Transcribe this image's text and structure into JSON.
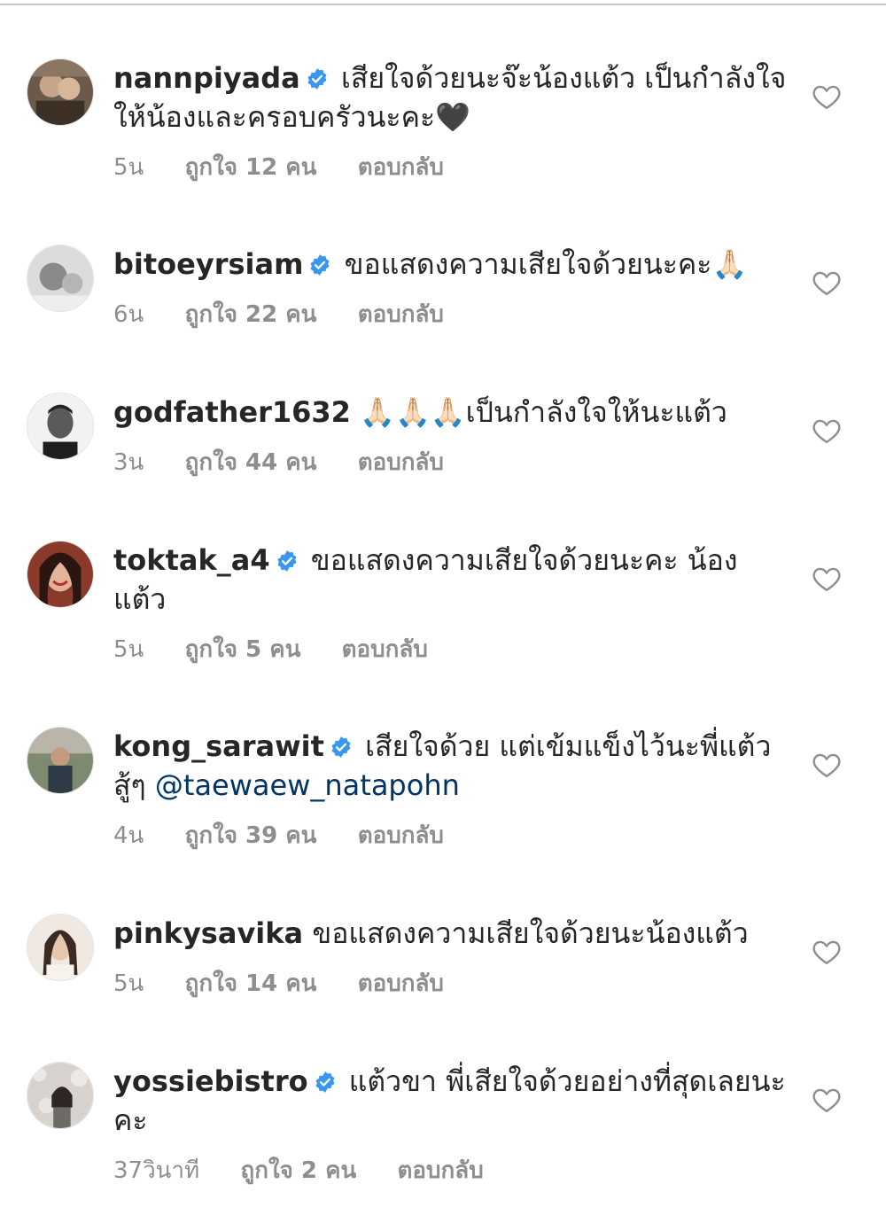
{
  "comments": [
    {
      "username": "nannpiyada",
      "verified": true,
      "text": "เสียใจด้วยนะจ๊ะน้องแต้ว เป็นกำลังใจให้น้องและครอบครัวนะคะ🖤",
      "time": "5น",
      "likes": "ถูกใจ 12 คน",
      "reply": "ตอบกลับ",
      "avatar_color": "#6b5a4a"
    },
    {
      "username": "bitoeyrsiam",
      "verified": true,
      "text": "ขอแสดงความเสียใจด้วยนะคะ🙏🏻",
      "time": "6น",
      "likes": "ถูกใจ 22 คน",
      "reply": "ตอบกลับ",
      "avatar_color": "#9a9a9a"
    },
    {
      "username": "godfather1632",
      "verified": false,
      "text": "🙏🏻🙏🏻🙏🏻เป็นกำลังใจให้นะแต้ว",
      "time": "3น",
      "likes": "ถูกใจ 44 คน",
      "reply": "ตอบกลับ",
      "avatar_color": "#3a3a3a"
    },
    {
      "username": "toktak_a4",
      "verified": true,
      "text": "ขอแสดงความเสียใจด้วยนะคะ น้องแต้ว",
      "time": "5น",
      "likes": "ถูกใจ 5 คน",
      "reply": "ตอบกลับ",
      "avatar_color": "#8a3a2a"
    },
    {
      "username": "kong_sarawit",
      "verified": true,
      "text": "เสียใจด้วย แต่เข้มแข็งไว้นะพี่แต้ว สู้ๆ ",
      "mention": "@taewaew_natapohn",
      "time": "4น",
      "likes": "ถูกใจ 39 คน",
      "reply": "ตอบกลับ",
      "avatar_color": "#5a6a4a"
    },
    {
      "username": "pinkysavika",
      "verified": false,
      "text": "ขอแสดงความเสียใจด้วยนะน้องแต้ว",
      "time": "5น",
      "likes": "ถูกใจ 14 คน",
      "reply": "ตอบกลับ",
      "avatar_color": "#d8cfc4"
    },
    {
      "username": "yossiebistro",
      "verified": true,
      "text": "แต้วขา พี่เสียใจด้วยอย่างที่สุดเลยนะคะ",
      "time": "37วินาที",
      "likes": "ถูกใจ 2 คน",
      "reply": "ตอบกลับ",
      "avatar_color": "#c9c2bc"
    }
  ],
  "icons": {
    "verified": "verified-badge-icon",
    "like": "heart-outline-icon"
  },
  "colors": {
    "verified": "#3897f0",
    "mention": "#003569",
    "meta": "#8e8e8e",
    "text": "#262626"
  }
}
